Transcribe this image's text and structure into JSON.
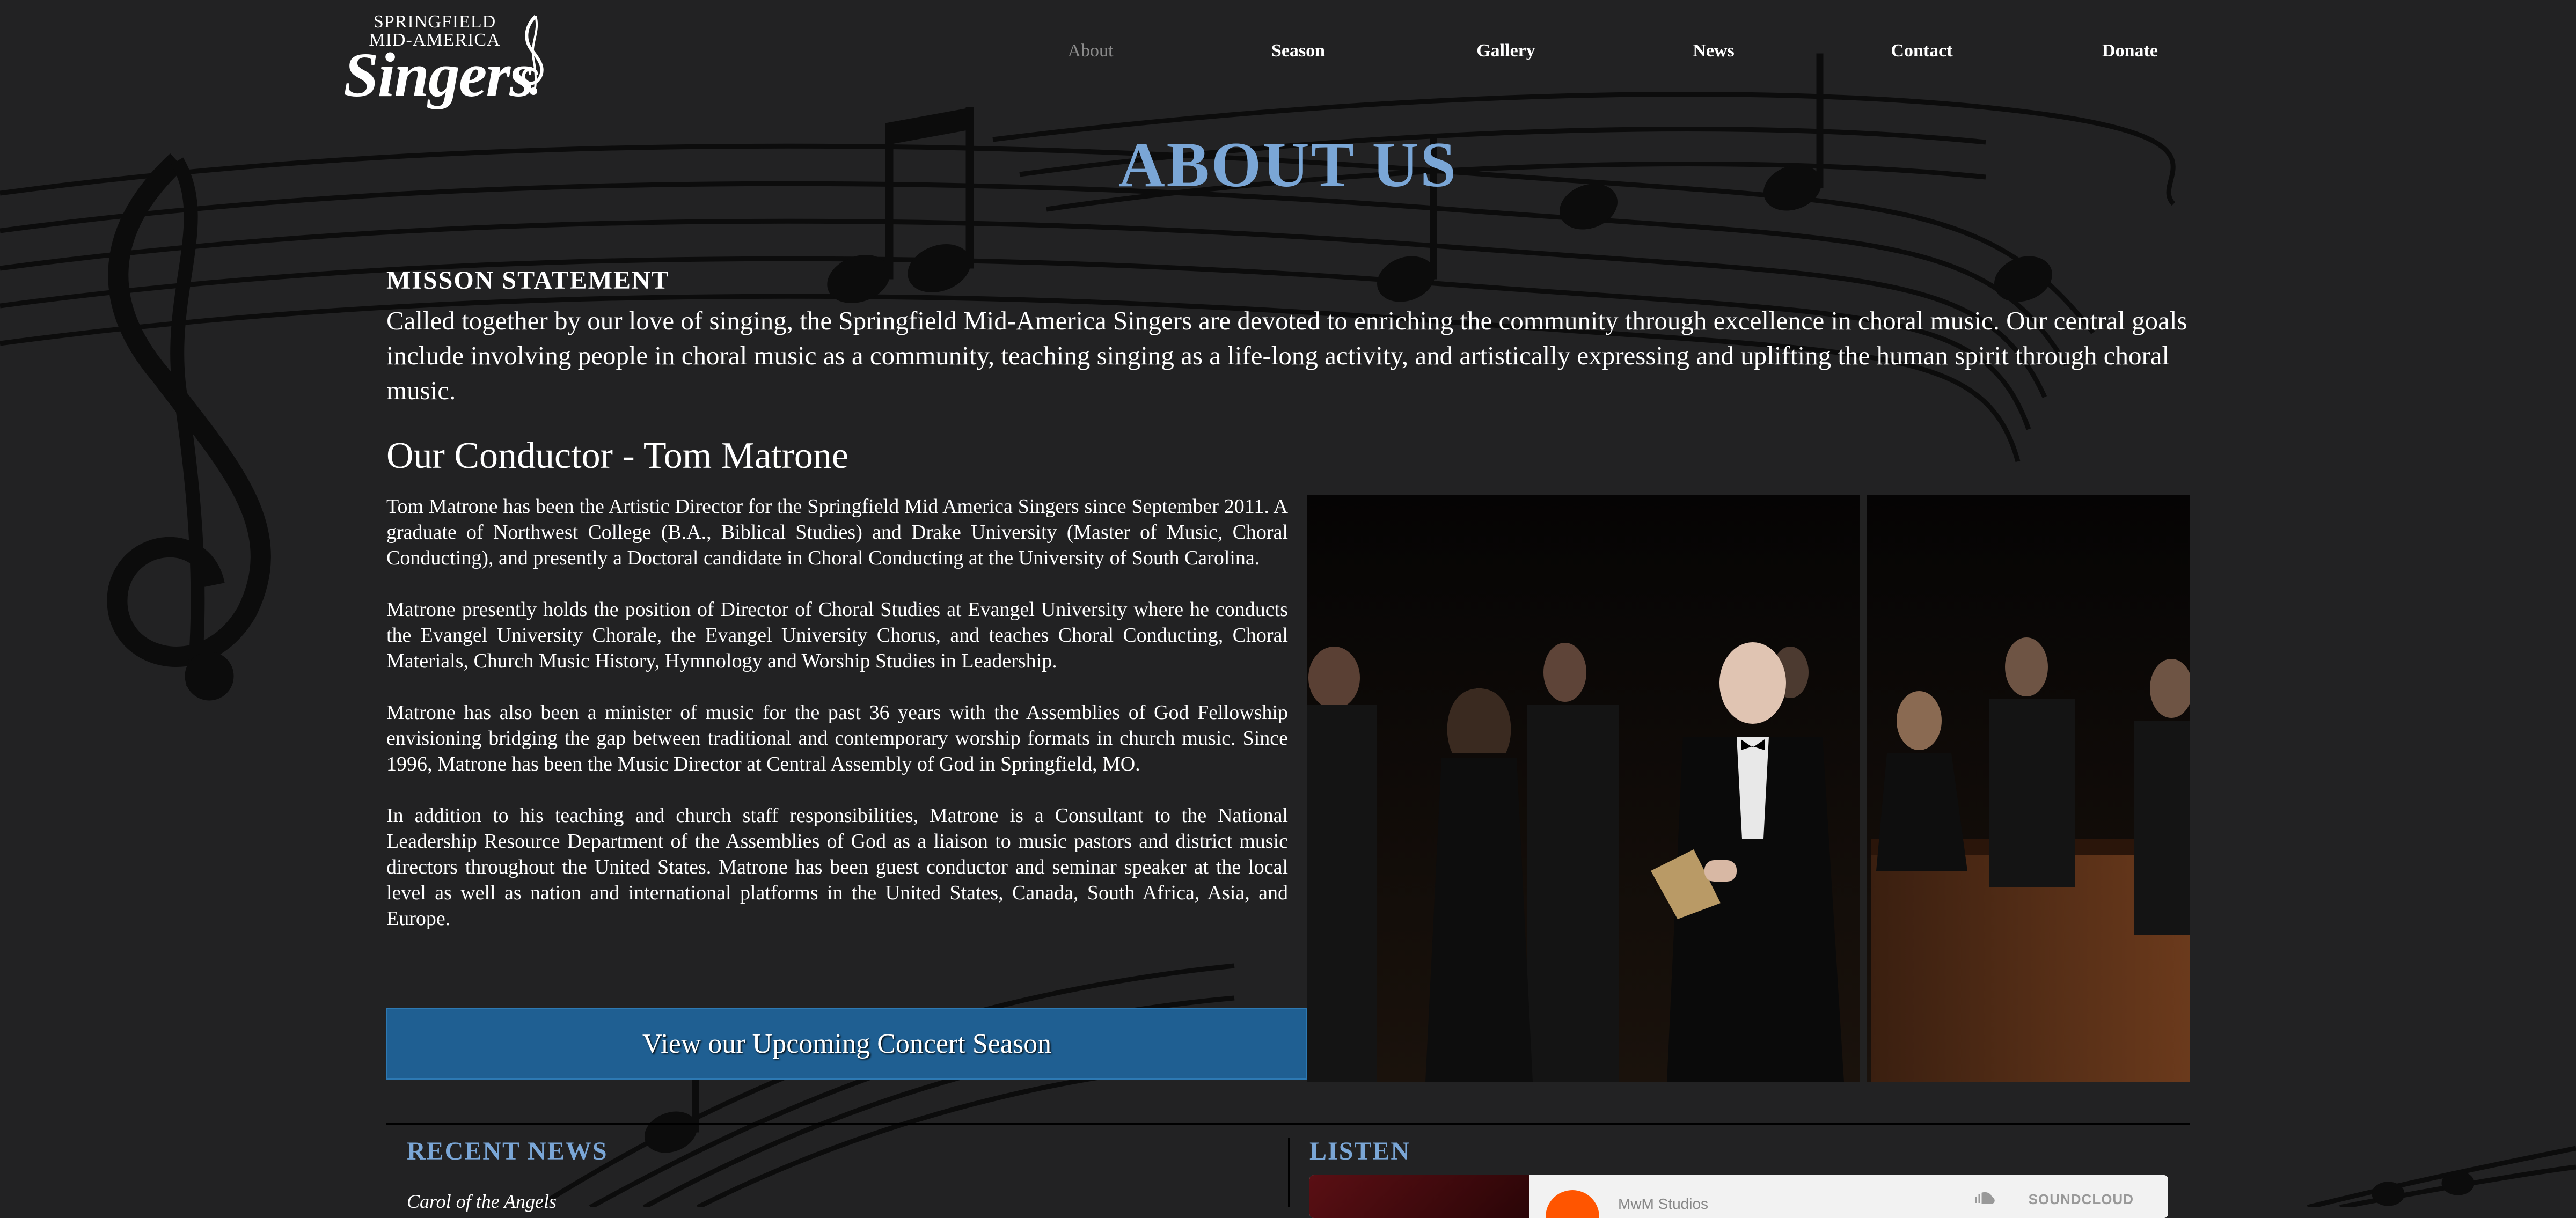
{
  "header": {
    "logo": {
      "line1": "SPRINGFIELD",
      "line2": "MID-AMERICA",
      "line3": "Singers"
    },
    "nav": [
      {
        "label": "About",
        "active": true
      },
      {
        "label": "Season",
        "active": false
      },
      {
        "label": "Gallery",
        "active": false
      },
      {
        "label": "News",
        "active": false
      },
      {
        "label": "Contact",
        "active": false
      },
      {
        "label": "Donate",
        "active": false
      }
    ]
  },
  "page": {
    "title": "ABOUT US",
    "mission_heading": "MISSON STATEMENT",
    "mission_text": "Called together by our love of singing, the Springfield Mid-America Singers are devoted to enriching the community through excellence in choral music. Our central goals include involving people in choral music as a community, teaching singing as a life-long activity, and artistically expressing and uplifting the human spirit through choral music.",
    "conductor_heading": "Our Conductor - Tom Matrone",
    "bio": [
      "Tom Matrone has been the Artistic Director for the Springfield Mid America Singers since September 2011. A graduate of Northwest College (B.A., Biblical Studies) and Drake University (Master of Music, Choral Conducting), and presently a Doctoral candidate in Choral Conducting at the University of South Carolina.",
      "Matrone presently holds the position of Director of Choral Studies at Evangel University where he conducts the Evangel University Chorale, the Evangel University Chorus, and teaches Choral Conducting, Choral Materials, Church Music History, Hymnology and Worship Studies in Leadership.",
      "Matrone has also been a minister of music for the past 36 years with the Assemblies of God Fellowship envisioning bridging the gap between traditional and contemporary worship formats in church music. Since 1996, Matrone has been the Music Director at Central Assembly of God in Springfield, MO.",
      "In addition to his teaching and church staff responsibilities, Matrone is a Consultant to the National Leadership Resource Department of the Assemblies of God as a liaison to music pastors and district music directors throughout the United States. Matrone has been guest conductor and seminar speaker at the local level as well as nation and international platforms in the United States, Canada, South Africa, Asia, and Europe."
    ],
    "cta_label": "View our Upcoming Concert Season"
  },
  "footer": {
    "news_heading": "RECENT NEWS",
    "news_items": [
      "Carol of the Angels"
    ],
    "listen_heading": "LISTEN",
    "soundcloud": {
      "artist": "MwM Studios",
      "brand": "SOUNDCLOUD"
    }
  },
  "colors": {
    "background": "#222223",
    "accent": "#7aa6d6",
    "button": "#1f5f92",
    "nav_active": "#8a8a8a"
  }
}
